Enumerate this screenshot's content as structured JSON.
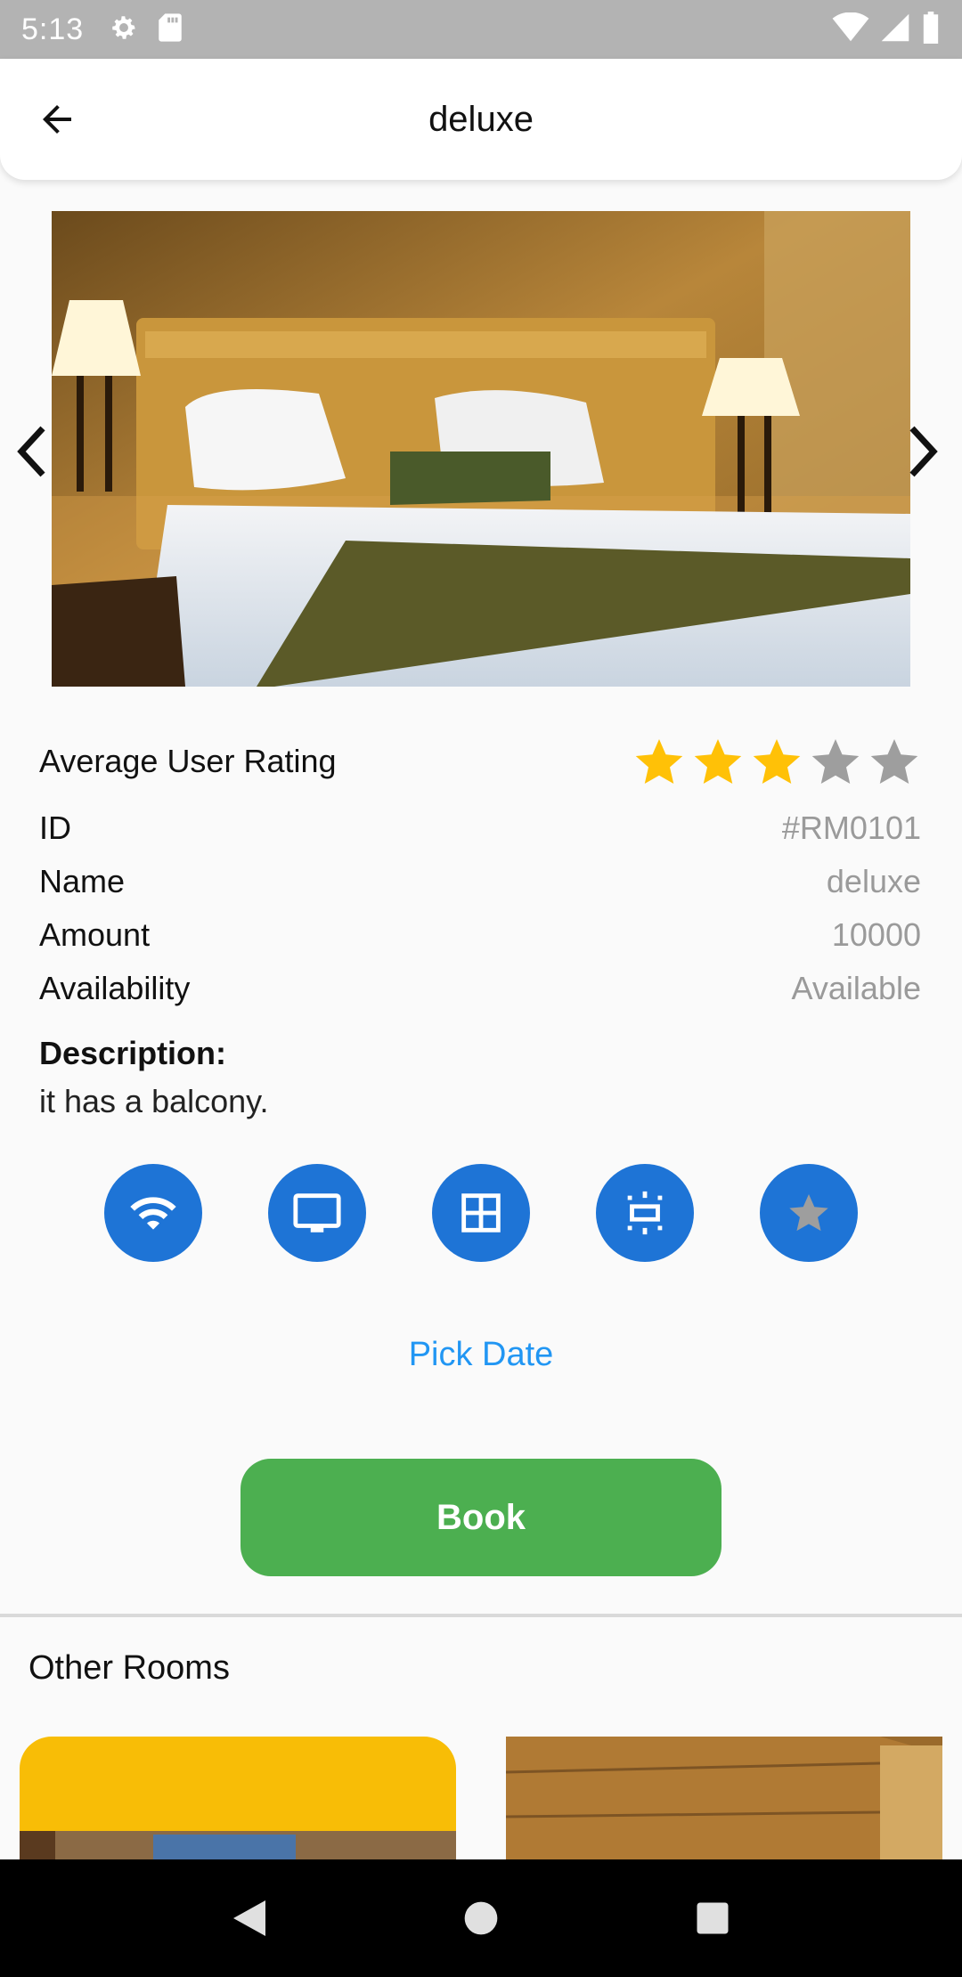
{
  "status_bar": {
    "time": "5:13"
  },
  "app_bar": {
    "title": "deluxe"
  },
  "rating": {
    "label": "Average User Rating",
    "value": 3,
    "max": 5,
    "filled_color": "#FFC107",
    "empty_color": "#9E9E9E"
  },
  "details": [
    {
      "key": "ID",
      "value": "#RM0101"
    },
    {
      "key": "Name",
      "value": "deluxe"
    },
    {
      "key": "Amount",
      "value": "10000"
    },
    {
      "key": "Availability",
      "value": "Available"
    }
  ],
  "description": {
    "title": "Description:",
    "text": "it has a balcony."
  },
  "amenities": [
    "wifi-icon",
    "tv-icon",
    "window-icon",
    "air-conditioner-icon",
    "star-icon"
  ],
  "pick_date_label": "Pick Date",
  "book_label": "Book",
  "other_rooms_title": "Other Rooms",
  "colors": {
    "accent_blue": "#1E74D6",
    "link_blue": "#2196F3",
    "book_green": "#4CAF50",
    "card_yellow": "#F8BD06"
  }
}
